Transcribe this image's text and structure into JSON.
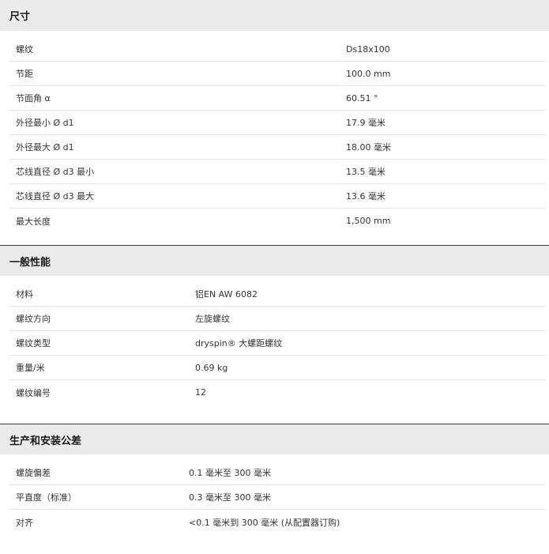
{
  "sections": [
    {
      "title": "尺寸",
      "rows": [
        {
          "label": "螺纹",
          "value": "Ds18x100"
        },
        {
          "label": "节距",
          "value": "100.0 mm"
        },
        {
          "label": "节面角 α",
          "value": "60.51 °"
        },
        {
          "label": "外径最小 Ø d1",
          "value": "17.9 毫米"
        },
        {
          "label": "外径最大 Ø d1",
          "value": "18.00 毫米"
        },
        {
          "label": "芯线直径 Ø d3 最小",
          "value": "13.5 毫米"
        },
        {
          "label": "芯线直径 Ø d3 最大",
          "value": "13.6 毫米"
        },
        {
          "label": "最大长度",
          "value": "1,500 mm"
        }
      ]
    },
    {
      "title": "一般性能",
      "rows": [
        {
          "label": "材料",
          "value": "铝EN AW 6082"
        },
        {
          "label": "螺纹方向",
          "value": "左旋螺纹"
        },
        {
          "label": "螺纹类型",
          "value": "dryspin® 大螺距螺纹"
        },
        {
          "label": "重量/米",
          "value": "0.69 kg"
        },
        {
          "label": "螺纹编号",
          "value": "12"
        }
      ]
    },
    {
      "title": "生产和安装公差",
      "rows": [
        {
          "label": "螺旋偏差",
          "value": "0.1 毫米至 300 毫米"
        },
        {
          "label": "平直度（标准）",
          "value": "0.3 毫米至 300 毫米"
        },
        {
          "label": "对齐",
          "value": "<0.1 毫米到 300 毫米 (从配置器订购)"
        }
      ]
    }
  ]
}
